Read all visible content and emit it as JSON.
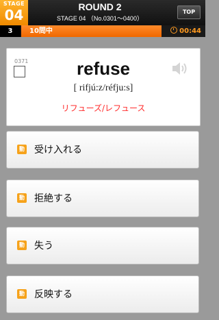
{
  "header": {
    "stage_label": "STAGE",
    "stage_number": "04",
    "round_title": "ROUND 2",
    "stage_subtitle": "STAGE 04 （No.0301～0400）",
    "top_button": "TOP"
  },
  "progress": {
    "question_number": "3",
    "status": "10問中",
    "timer": "00:44"
  },
  "card": {
    "word_id": "0371",
    "word": "refuse",
    "pronunciation": "[ rifjú:z/réfju:s]",
    "katakana": "リフューズ/レフュース",
    "speaker_icon": "speaker-icon"
  },
  "answers": [
    {
      "pos": "動",
      "label": "受け入れる"
    },
    {
      "pos": "動",
      "label": "拒絶する"
    },
    {
      "pos": "動",
      "label": "失う"
    },
    {
      "pos": "動",
      "label": "反映する"
    }
  ],
  "colors": {
    "accent": "#f08a00",
    "pos_badge": "#f6a21a",
    "katakana": "#ff2a2a"
  }
}
